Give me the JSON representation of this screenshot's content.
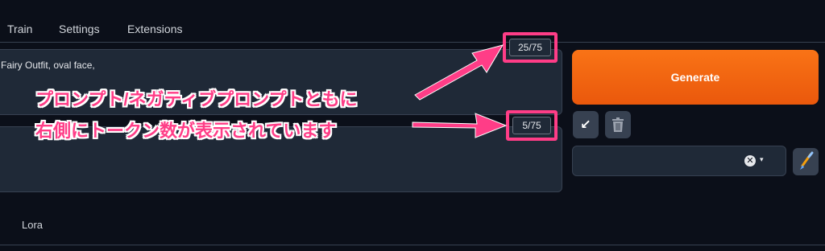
{
  "tabs": [
    "Train",
    "Settings",
    "Extensions"
  ],
  "prompt": {
    "text": "Fairy Outfit, oval face,",
    "token_count": "25/75"
  },
  "negative_prompt": {
    "text": "",
    "token_count": "5/75"
  },
  "generate_label": "Generate",
  "buttons": {
    "arrow": "↙",
    "clear_icon_glyph": "✕",
    "caret_glyph": "▾"
  },
  "lora_tab": "Lora",
  "annotation": {
    "line1": "プロンプト/ネガティブプロンプトともに",
    "line2": "右側にトークン数が表示されています"
  },
  "colors": {
    "accent": "#f97316",
    "highlight": "#ff3d87",
    "background": "#0b0f19"
  },
  "icons": [
    "arrow-down-left-icon",
    "trash-icon",
    "clear-icon",
    "chevron-down-icon",
    "paintbrush-icon"
  ]
}
